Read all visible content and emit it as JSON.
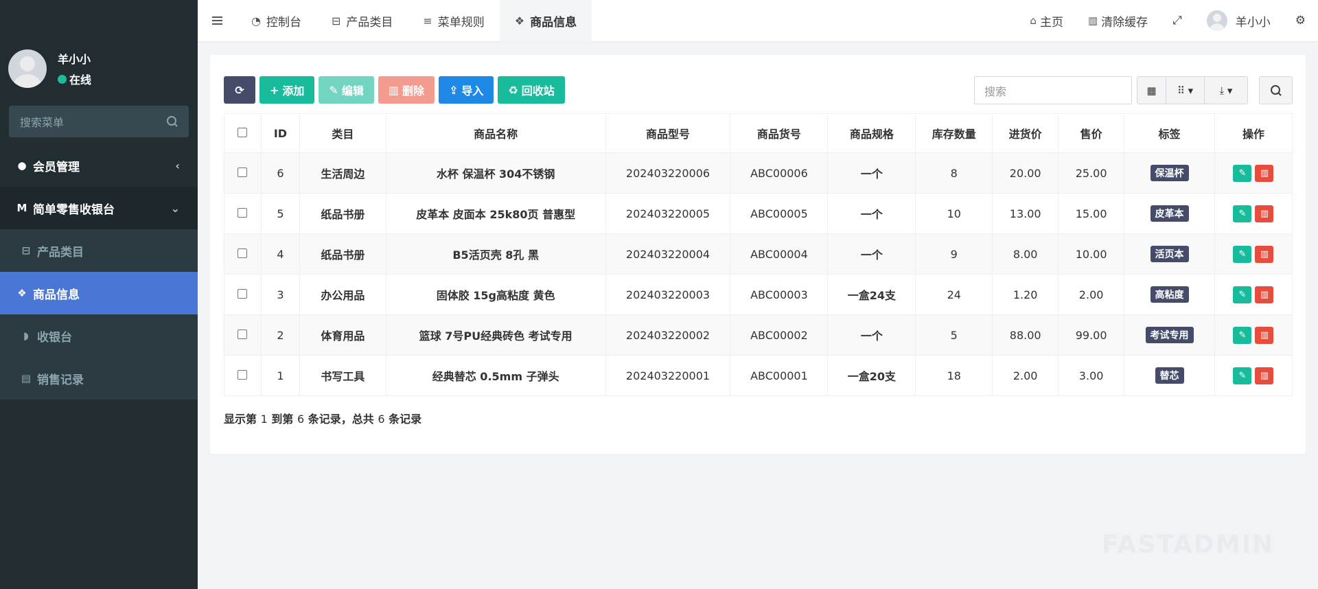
{
  "sidebar": {
    "user_name": "羊小小",
    "user_status": "在线",
    "search_placeholder": "搜索菜单",
    "menu": {
      "member": "会员管理",
      "retail": "简单零售收银台",
      "category": "产品类目",
      "goods": "商品信息",
      "cashier": "收银台",
      "sales": "销售记录"
    }
  },
  "topnav": {
    "tabs": [
      "控制台",
      "产品类目",
      "菜单规则",
      "商品信息"
    ],
    "home": "主页",
    "clear_cache": "清除缓存",
    "user_name": "羊小小"
  },
  "toolbar": {
    "add": "添加",
    "edit": "编辑",
    "delete": "删除",
    "import": "导入",
    "recycle": "回收站",
    "search_placeholder": "搜索"
  },
  "table": {
    "headers": [
      "ID",
      "类目",
      "商品名称",
      "商品型号",
      "商品货号",
      "商品规格",
      "库存数量",
      "进货价",
      "售价",
      "标签",
      "操作"
    ],
    "rows": [
      {
        "id": "6",
        "category": "生活周边",
        "name": "水杯 保温杯 304不锈钢",
        "model": "202403220006",
        "sku": "ABC00006",
        "spec": "一个",
        "stock": "8",
        "cost": "20.00",
        "price": "25.00",
        "tag": "保温杯"
      },
      {
        "id": "5",
        "category": "纸品书册",
        "name": "皮革本 皮面本 25k80页 普惠型",
        "model": "202403220005",
        "sku": "ABC00005",
        "spec": "一个",
        "stock": "10",
        "cost": "13.00",
        "price": "15.00",
        "tag": "皮革本"
      },
      {
        "id": "4",
        "category": "纸品书册",
        "name": "B5活页壳 8孔 黑",
        "model": "202403220004",
        "sku": "ABC00004",
        "spec": "一个",
        "stock": "9",
        "cost": "8.00",
        "price": "10.00",
        "tag": "活页本"
      },
      {
        "id": "3",
        "category": "办公用品",
        "name": "固体胶 15g高粘度 黄色",
        "model": "202403220003",
        "sku": "ABC00003",
        "spec": "一盒24支",
        "stock": "24",
        "cost": "1.20",
        "price": "2.00",
        "tag": "高粘度"
      },
      {
        "id": "2",
        "category": "体育用品",
        "name": "篮球 7号PU经典砖色 考试专用",
        "model": "202403220002",
        "sku": "ABC00002",
        "spec": "一个",
        "stock": "5",
        "cost": "88.00",
        "price": "99.00",
        "tag": "考试专用"
      },
      {
        "id": "1",
        "category": "书写工具",
        "name": "经典替芯 0.5mm 子弹头",
        "model": "202403220001",
        "sku": "ABC00001",
        "spec": "一盒20支",
        "stock": "18",
        "cost": "2.00",
        "price": "3.00",
        "tag": "替芯"
      }
    ]
  },
  "pager": {
    "p1": "显示第",
    "from": "1",
    "p2": "到第",
    "to": "6",
    "p3": "条记录，总共",
    "total": "6",
    "p4": "条记录"
  },
  "watermark": "FASTADMIN",
  "colors": {
    "sidebar_bg": "#222d32",
    "active_menu": "#4a76d6",
    "success": "#18bc9c",
    "danger": "#e74c3c",
    "primary": "#1e88e5",
    "tag_bg": "#444c69"
  }
}
